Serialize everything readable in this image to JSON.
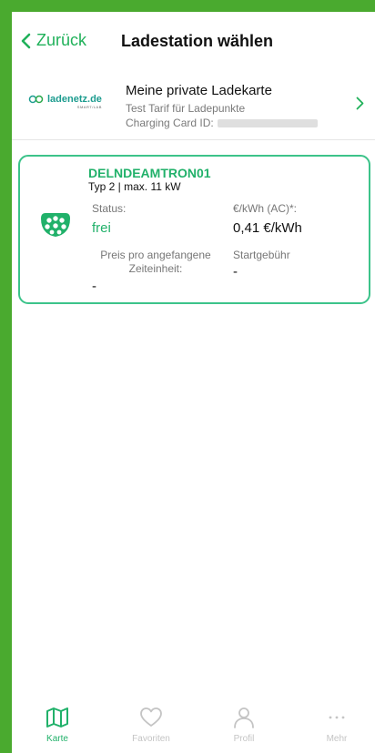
{
  "header": {
    "back_label": "Zurück",
    "title": "Ladestation wählen"
  },
  "card": {
    "logo_text": "ladenetz.de",
    "logo_subtext": "SMART/LAB",
    "title": "Meine private Ladekarte",
    "tariff": "Test Tarif für Ladepunkte",
    "id_label": "Charging Card ID:"
  },
  "station": {
    "name": "DELNDEAMTRON01",
    "type": "Typ 2 | max. 11 kW",
    "status_label": "Status:",
    "status_value": "frei",
    "price_label": "€/kWh (AC)*:",
    "price_value": "0,41 €/kWh",
    "time_price_label": "Preis pro angefangene Zeiteinheit:",
    "time_price_value": "-",
    "start_fee_label": "Startgebühr",
    "start_fee_value": "-"
  },
  "nav": [
    {
      "label": "Karte",
      "icon": "map-icon",
      "active": true
    },
    {
      "label": "Favoriten",
      "icon": "heart-icon",
      "active": false
    },
    {
      "label": "Profil",
      "icon": "person-icon",
      "active": false
    },
    {
      "label": "Mehr",
      "icon": "more-icon",
      "active": false
    }
  ],
  "colors": {
    "accent": "#21b16a",
    "frame": "#4aaa2f",
    "card_border": "#3cc38a",
    "inactive": "#c4c4c4"
  }
}
